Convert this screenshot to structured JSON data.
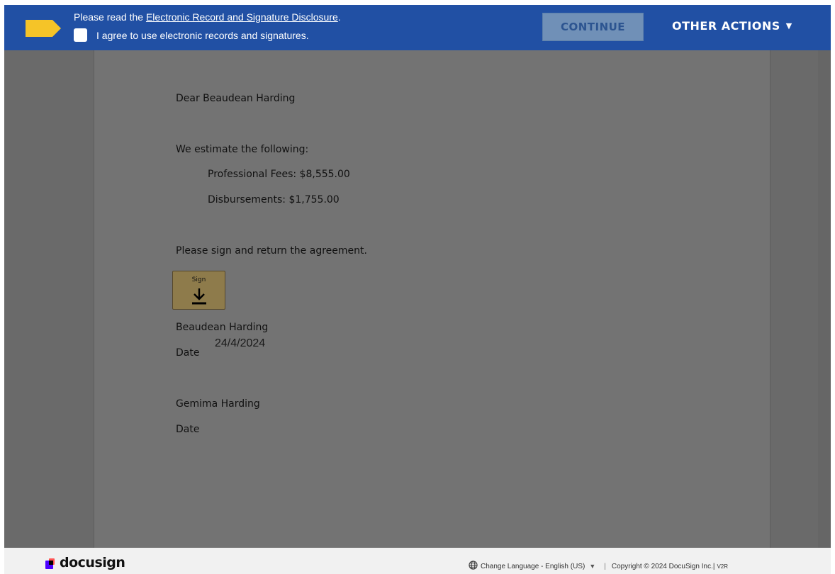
{
  "banner": {
    "read_prefix": "Please read the ",
    "disclosure_link": "Electronic Record and Signature Disclosure",
    "read_suffix": ".",
    "agree_label": "I agree to use electronic records and signatures.",
    "continue_label": "CONTINUE",
    "other_actions_label": "OTHER ACTIONS",
    "other_actions_caret": "▼",
    "flag_color": "#f5c428",
    "background_color": "#2150a4"
  },
  "document": {
    "salutation": "Dear Beaudean Harding",
    "estimate_intro": "We estimate the following:",
    "professional_fees": "Professional Fees: $8,555.00",
    "disbursements": "Disbursements: $1,755.00",
    "sign_request": "Please sign and return the agreement.",
    "sign_tab_label": "Sign",
    "signer1_name": "Beaudean Harding",
    "signer1_date_label": "Date",
    "signer1_date_value": "24/4/2024",
    "signer2_name": "Gemima Harding",
    "signer2_date_label": "Date"
  },
  "footer": {
    "brand": "docusign",
    "change_language": "Change Language - English (US)",
    "language_caret": "▼",
    "separator": "|",
    "copyright": "Copyright © 2024 DocuSign Inc.|",
    "version": "V2R"
  },
  "icons": {
    "flag": "tag-flag-icon",
    "sign_arrow": "download-arrow-icon",
    "globe": "globe-icon"
  }
}
